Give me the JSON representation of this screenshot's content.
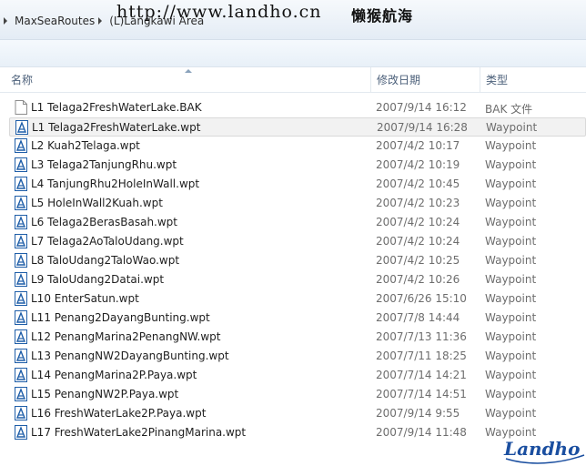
{
  "breadcrumb": {
    "items": [
      "MaxSeaRoutes",
      "(L)Langkawi Area"
    ]
  },
  "watermark": {
    "url": "http://www.landho.cn",
    "cn": "懒猴航海"
  },
  "columns": {
    "name": "名称",
    "date": "修改日期",
    "type": "类型"
  },
  "files": [
    {
      "name": "L1 Telaga2FreshWaterLake.BAK",
      "date": "2007/9/14 16:12",
      "type": "BAK 文件",
      "icon": "blank-file-icon"
    },
    {
      "name": "L1 Telaga2FreshWaterLake.wpt",
      "date": "2007/9/14 16:28",
      "type": "Waypoint",
      "icon": "waypoint-file-icon"
    },
    {
      "name": "L2 Kuah2Telaga.wpt",
      "date": "2007/4/2 10:17",
      "type": "Waypoint",
      "icon": "waypoint-file-icon"
    },
    {
      "name": "L3 Telaga2TanjungRhu.wpt",
      "date": "2007/4/2 10:19",
      "type": "Waypoint",
      "icon": "waypoint-file-icon"
    },
    {
      "name": "L4 TanjungRhu2HoleInWall.wpt",
      "date": "2007/4/2 10:45",
      "type": "Waypoint",
      "icon": "waypoint-file-icon"
    },
    {
      "name": "L5 HoleInWall2Kuah.wpt",
      "date": "2007/4/2 10:23",
      "type": "Waypoint",
      "icon": "waypoint-file-icon"
    },
    {
      "name": "L6 Telaga2BerasBasah.wpt",
      "date": "2007/4/2 10:24",
      "type": "Waypoint",
      "icon": "waypoint-file-icon"
    },
    {
      "name": "L7 Telaga2AoTaloUdang.wpt",
      "date": "2007/4/2 10:24",
      "type": "Waypoint",
      "icon": "waypoint-file-icon"
    },
    {
      "name": "L8 TaloUdang2TaloWao.wpt",
      "date": "2007/4/2 10:25",
      "type": "Waypoint",
      "icon": "waypoint-file-icon"
    },
    {
      "name": "L9 TaloUdang2Datai.wpt",
      "date": "2007/4/2 10:26",
      "type": "Waypoint",
      "icon": "waypoint-file-icon"
    },
    {
      "name": "L10 EnterSatun.wpt",
      "date": "2007/6/26 15:10",
      "type": "Waypoint",
      "icon": "waypoint-file-icon"
    },
    {
      "name": "L11 Penang2DayangBunting.wpt",
      "date": "2007/7/8 14:44",
      "type": "Waypoint",
      "icon": "waypoint-file-icon"
    },
    {
      "name": "L12 PenangMarina2PenangNW.wpt",
      "date": "2007/7/13 11:36",
      "type": "Waypoint",
      "icon": "waypoint-file-icon"
    },
    {
      "name": "L13 PenangNW2DayangBunting.wpt",
      "date": "2007/7/11 18:25",
      "type": "Waypoint",
      "icon": "waypoint-file-icon"
    },
    {
      "name": "L14 PenangMarina2P.Paya.wpt",
      "date": "2007/7/14 14:21",
      "type": "Waypoint",
      "icon": "waypoint-file-icon"
    },
    {
      "name": "L15 PenangNW2P.Paya.wpt",
      "date": "2007/7/14 14:51",
      "type": "Waypoint",
      "icon": "waypoint-file-icon"
    },
    {
      "name": "L16 FreshWaterLake2P.Paya.wpt",
      "date": "2007/9/14 9:55",
      "type": "Waypoint",
      "icon": "waypoint-file-icon"
    },
    {
      "name": "L17 FreshWaterLake2PinangMarina.wpt",
      "date": "2007/9/14 11:48",
      "type": "Waypoint",
      "icon": "waypoint-file-icon"
    }
  ],
  "logo": {
    "text": "Landho"
  },
  "colors": {
    "header_text": "#4c607a",
    "meta_text": "#6d6d6d",
    "icon_blue": "#1f5ea8",
    "logo_blue": "#1b4fa0"
  }
}
